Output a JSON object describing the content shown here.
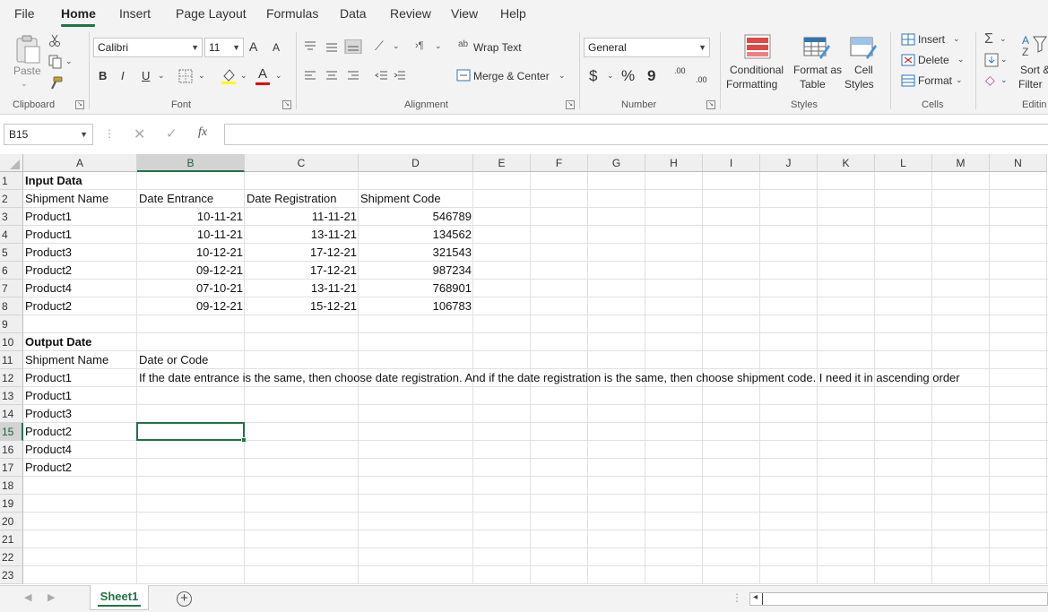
{
  "menu": {
    "tabs": [
      {
        "label": "File",
        "active": false
      },
      {
        "label": "Home",
        "active": true
      },
      {
        "label": "Insert",
        "active": false
      },
      {
        "label": "Page Layout",
        "active": false
      },
      {
        "label": "Formulas",
        "active": false
      },
      {
        "label": "Data",
        "active": false
      },
      {
        "label": "Review",
        "active": false
      },
      {
        "label": "View",
        "active": false
      },
      {
        "label": "Help",
        "active": false
      }
    ]
  },
  "ribbon": {
    "clipboard": {
      "label": "Clipboard",
      "paste_label": "Paste"
    },
    "font": {
      "label": "Font",
      "font_name": "Calibri",
      "font_size": "11",
      "bold": "B",
      "italic": "I",
      "underline": "U",
      "grow": "A",
      "shrink": "A",
      "font_color_glyph": "A"
    },
    "alignment": {
      "label": "Alignment",
      "wrap_text": "Wrap Text",
      "merge_center": "Merge & Center"
    },
    "number": {
      "label": "Number",
      "format": "General",
      "currency": "$",
      "percent": "%",
      "comma": "9",
      "inc_decimal": ".00",
      "dec_decimal": ".00"
    },
    "styles": {
      "label": "Styles",
      "conditional_l1": "Conditional",
      "conditional_l2": "Formatting",
      "format_table_l1": "Format as",
      "format_table_l2": "Table",
      "cell_styles_l1": "Cell",
      "cell_styles_l2": "Styles"
    },
    "cells": {
      "label": "Cells",
      "insert": "Insert",
      "delete": "Delete",
      "format": "Format"
    },
    "editing": {
      "label": "Editin",
      "sort_l1": "Sort &",
      "sort_l2": "Filter"
    },
    "accent": "#217346"
  },
  "formula_bar": {
    "name_box": "B15",
    "fx": "fx",
    "formula": ""
  },
  "grid": {
    "columns": [
      "A",
      "B",
      "C",
      "D",
      "E",
      "F",
      "G",
      "H",
      "I",
      "J",
      "K",
      "L",
      "M",
      "N"
    ],
    "rows": [
      "1",
      "2",
      "3",
      "4",
      "5",
      "6",
      "7",
      "8",
      "9",
      "10",
      "11",
      "12",
      "13",
      "14",
      "15",
      "16",
      "17",
      "18",
      "19",
      "20",
      "21",
      "22",
      "23"
    ],
    "selected_cell": "B15",
    "selected_col": "B",
    "selected_row": "15",
    "cells": {
      "A1": "Input Data",
      "A2": "Shipment Name",
      "B2": "Date Entrance",
      "C2": "Date Registration",
      "D2": "Shipment Code",
      "A3": "Product1",
      "B3": "10-11-21",
      "C3": "11-11-21",
      "D3": "546789",
      "A4": "Product1",
      "B4": "10-11-21",
      "C4": "13-11-21",
      "D4": "134562",
      "A5": "Product3",
      "B5": "10-12-21",
      "C5": "17-12-21",
      "D5": "321543",
      "A6": "Product2",
      "B6": "09-12-21",
      "C6": "17-12-21",
      "D6": "987234",
      "A7": "Product4",
      "B7": "07-10-21",
      "C7": "13-11-21",
      "D7": "768901",
      "A8": "Product2",
      "B8": "09-12-21",
      "C8": "15-12-21",
      "D8": "106783",
      "A10": "Output Date",
      "A11": "Shipment Name",
      "B11": "Date or Code",
      "A12": "Product1",
      "B12": "If the date entrance is the same, then choose date registration. And if the date registration is the same, then choose shipment code. I need it in ascending order",
      "A13": "Product1",
      "A14": "Product3",
      "A15": "Product2",
      "A16": "Product4",
      "A17": "Product2"
    }
  },
  "sheets": {
    "tabs": [
      "Sheet1"
    ],
    "add_glyph": "+"
  }
}
